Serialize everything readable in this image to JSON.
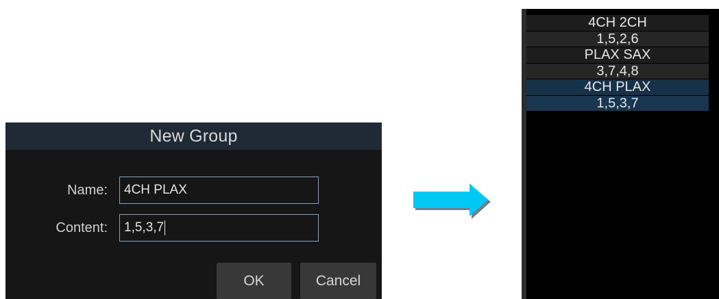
{
  "dialog": {
    "title": "New Group",
    "name_label": "Name:",
    "name_value": "4CH PLAX",
    "content_label": "Content:",
    "content_value": "1,5,3,7",
    "ok_label": "OK",
    "cancel_label": "Cancel"
  },
  "colors": {
    "arrow": "#00c8f5",
    "selected_row": "#173149",
    "input_border": "#8aa5bd"
  },
  "groups": [
    {
      "name": "4CH 2CH",
      "content": "1,5,2,6",
      "selected": false
    },
    {
      "name": "PLAX SAX",
      "content": "3,7,4,8",
      "selected": false
    },
    {
      "name": "4CH PLAX",
      "content": "1,5,3,7",
      "selected": true
    }
  ]
}
